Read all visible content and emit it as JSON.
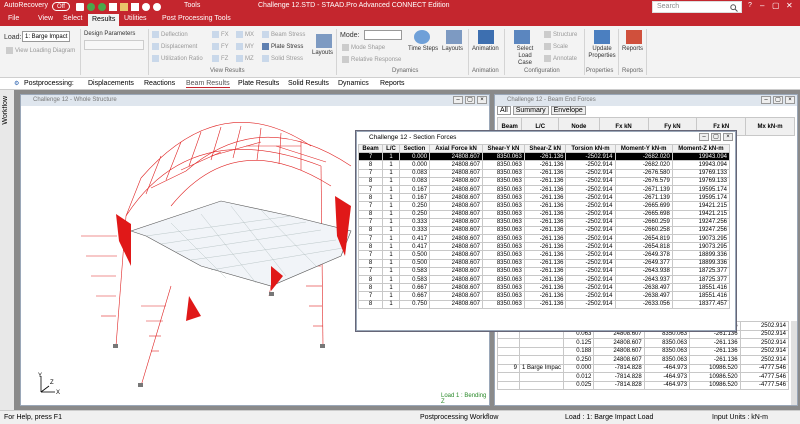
{
  "title_bar": {
    "autorecovery_label": "AutoRecovery",
    "autorecovery_state": "Off",
    "tools_label": "Tools",
    "window_title": "Challenge 12.STD - STAAD.Pro Advanced CONNECT Edition",
    "search_placeholder": "Search"
  },
  "menu": [
    "File",
    "View",
    "Select",
    "Results",
    "Utilities",
    "Post Processing Tools"
  ],
  "active_menu": "Results",
  "ribbon": {
    "load_label": "Load:",
    "load_value": "1: Barge Impact",
    "view_loading_diagram": "View Loading Diagram",
    "design_parameters": "Design Parameters",
    "view_results_items": [
      "Deflection",
      "Displacement",
      "Utilization Ratio"
    ],
    "fx_items": [
      "FX",
      "FY",
      "FZ"
    ],
    "mx_items": [
      "MX",
      "MY",
      "MZ"
    ],
    "stress_items": [
      "Beam Stress",
      "Plate Stress",
      "Solid Stress"
    ],
    "layouts": "Layouts",
    "view_results_group": "View Results",
    "mode_label": "Mode:",
    "mode_shape": "Mode Shape",
    "relative_response": "Relative Response",
    "time_steps": "Time Steps",
    "layouts2": "Layouts",
    "dynamics_group": "Dynamics",
    "animation": "Animation",
    "animation_group": "Animation",
    "select_load_case": "Select Load Case",
    "structure": "Structure",
    "scale": "Scale",
    "annotate": "Annotate",
    "configuration_group": "Configuration",
    "update_properties": "Update Properties",
    "properties_group": "Properties",
    "reports": "Reports",
    "reports_group": "Reports"
  },
  "postprocessing_tabs": {
    "label": "Postprocessing:",
    "tabs": [
      "Displacements",
      "Reactions",
      "Beam Results",
      "Plate Results",
      "Solid Results",
      "Dynamics",
      "Reports"
    ],
    "active": "Beam Results"
  },
  "workflow_label": "Workflow",
  "structure_window": {
    "title": "Challenge 12 - Whole Structure",
    "legend": "Load 1 : Bending Z",
    "axis_y": "Y",
    "axis_x": "X",
    "axis_z": "Z"
  },
  "beam_end_window": {
    "title": "Challenge 12 - Beam End Forces",
    "tabs": [
      "All",
      "Summary",
      "Envelope"
    ],
    "headers": [
      "Beam",
      "L/C",
      "Node",
      "Fx kN",
      "Fy kN",
      "Fz kN",
      "Mx kN-m"
    ],
    "rows": [
      [
        "8",
        "1 Barge Impac",
        "0.000",
        "24808.607",
        "8350.063",
        "-261.136",
        "2502.914"
      ],
      [
        "",
        "",
        "0.063",
        "24808.607",
        "8350.063",
        "-261.136",
        "2502.914"
      ],
      [
        "",
        "",
        "0.125",
        "24808.607",
        "8350.063",
        "-261.136",
        "2502.914"
      ],
      [
        "",
        "",
        "0.188",
        "24808.607",
        "8350.063",
        "-261.136",
        "2502.914"
      ],
      [
        "",
        "",
        "0.250",
        "24808.607",
        "8350.063",
        "-261.136",
        "2502.914"
      ],
      [
        "9",
        "1 Barge Impac",
        "0.000",
        "-7814.828",
        "-464.973",
        "10986.520",
        "-4777.546"
      ],
      [
        "",
        "",
        "0.012",
        "-7814.828",
        "-464.973",
        "10986.520",
        "-4777.546"
      ],
      [
        "",
        "",
        "0.025",
        "-7814.828",
        "-464.973",
        "10986.520",
        "-4777.546"
      ]
    ]
  },
  "section_forces": {
    "title": "Challenge 12 - Section Forces",
    "headers": [
      "Beam",
      "L/C",
      "Section",
      "Axial Force kN",
      "Shear-Y kN",
      "Shear-Z kN",
      "Torsion kN-m",
      "Moment-Y kN-m",
      "Moment-Z kN-m"
    ],
    "rows": [
      [
        "7",
        "1",
        "0.000",
        "24808.607",
        "8350.063",
        "-261.136",
        "-2502.914",
        "-2682.020",
        "19943.094"
      ],
      [
        "8",
        "1",
        "0.000",
        "24808.607",
        "8350.063",
        "-261.136",
        "-2502.914",
        "-2682.020",
        "19943.094"
      ],
      [
        "7",
        "1",
        "0.083",
        "24808.607",
        "8350.063",
        "-261.136",
        "-2502.914",
        "-2676.580",
        "19769.133"
      ],
      [
        "8",
        "1",
        "0.083",
        "24808.607",
        "8350.063",
        "-261.136",
        "-2502.914",
        "-2676.579",
        "19769.133"
      ],
      [
        "7",
        "1",
        "0.167",
        "24808.607",
        "8350.063",
        "-261.136",
        "-2502.914",
        "-2671.139",
        "19595.174"
      ],
      [
        "8",
        "1",
        "0.167",
        "24808.607",
        "8350.063",
        "-261.136",
        "-2502.914",
        "-2671.139",
        "19595.174"
      ],
      [
        "7",
        "1",
        "0.250",
        "24808.607",
        "8350.063",
        "-261.136",
        "-2502.914",
        "-2665.699",
        "19421.215"
      ],
      [
        "8",
        "1",
        "0.250",
        "24808.607",
        "8350.063",
        "-261.136",
        "-2502.914",
        "-2665.698",
        "19421.215"
      ],
      [
        "7",
        "1",
        "0.333",
        "24808.607",
        "8350.063",
        "-261.136",
        "-2502.914",
        "-2660.259",
        "19247.256"
      ],
      [
        "8",
        "1",
        "0.333",
        "24808.607",
        "8350.063",
        "-261.136",
        "-2502.914",
        "-2660.258",
        "19247.256"
      ],
      [
        "7",
        "1",
        "0.417",
        "24808.607",
        "8350.063",
        "-261.136",
        "-2502.914",
        "-2654.819",
        "19073.295"
      ],
      [
        "8",
        "1",
        "0.417",
        "24808.607",
        "8350.063",
        "-261.136",
        "-2502.914",
        "-2654.818",
        "19073.295"
      ],
      [
        "7",
        "1",
        "0.500",
        "24808.607",
        "8350.063",
        "-261.136",
        "-2502.914",
        "-2649.378",
        "18899.336"
      ],
      [
        "8",
        "1",
        "0.500",
        "24808.607",
        "8350.063",
        "-261.136",
        "-2502.914",
        "-2649.377",
        "18899.336"
      ],
      [
        "7",
        "1",
        "0.583",
        "24808.607",
        "8350.063",
        "-261.136",
        "-2502.914",
        "-2643.938",
        "18725.377"
      ],
      [
        "8",
        "1",
        "0.583",
        "24808.607",
        "8350.063",
        "-261.136",
        "-2502.914",
        "-2643.937",
        "18725.377"
      ],
      [
        "8",
        "1",
        "0.667",
        "24808.607",
        "8350.063",
        "-261.136",
        "-2502.914",
        "-2638.497",
        "18551.416"
      ],
      [
        "7",
        "1",
        "0.667",
        "24808.607",
        "8350.063",
        "-261.136",
        "-2502.914",
        "-2638.497",
        "18551.416"
      ],
      [
        "8",
        "1",
        "0.750",
        "24808.607",
        "8350.063",
        "-261.136",
        "-2502.914",
        "-2633.056",
        "18377.457"
      ]
    ]
  },
  "status_bar": {
    "help": "For Help, press F1",
    "workflow": "Postprocessing Workflow",
    "load": "Load : 1: Barge Impact Load",
    "units": "Input Units : kN-m"
  }
}
